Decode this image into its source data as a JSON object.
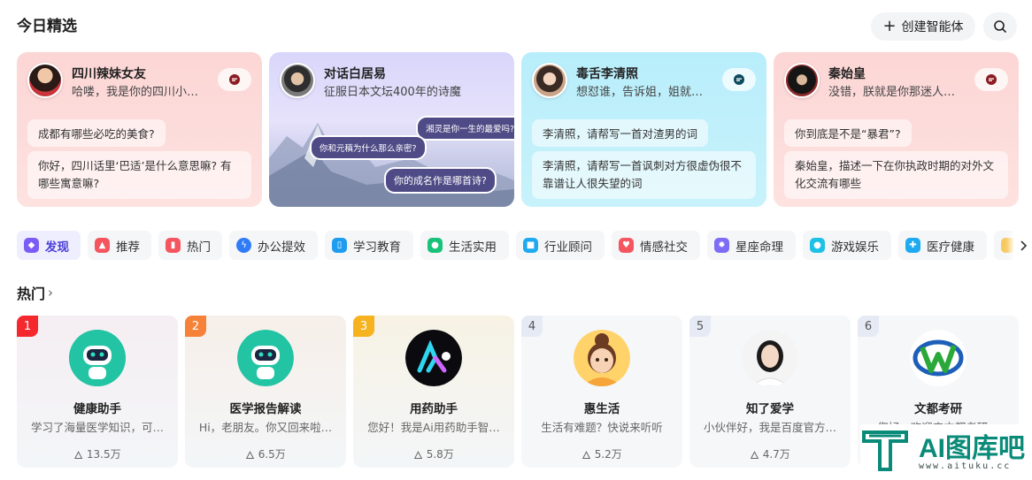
{
  "header": {
    "title": "今日精选",
    "create_label": "创建智能体"
  },
  "featured": [
    {
      "name": "四川辣妹女友",
      "greeting": "哈喽，我是你的四川小…",
      "q": "成都有哪些必吃的美食?",
      "a": "你好，四川话里‘巴适’是什么意思嘛? 有哪些寓意嘛?",
      "bg": "#fdd7d6"
    },
    {
      "name": "对话白居易",
      "greeting": "征服日本文坛400年的诗魔",
      "bubbles": [
        "湘灵是你一生的最爱吗?",
        "你和元稹为什么那么亲密?",
        "你的成名作是哪首诗?"
      ],
      "bg": "#dcd8fb"
    },
    {
      "name": "毒舌李清照",
      "greeting": "想怼谁，告诉姐，姐就…",
      "q": "李清照，请帮写一首对渣男的词",
      "a": "李清照，请帮写一首讽刺对方很虚伪很不靠谱让人很失望的词",
      "bg": "#bff0fb"
    },
    {
      "name": "秦始皇",
      "greeting": "没错，朕就是你那迷人…",
      "q": "你到底是不是“暴君”?",
      "a": "秦始皇，描述一下在你执政时期的对外文化交流有哪些",
      "bg": "#fdd7d6"
    }
  ],
  "tabs": [
    {
      "label": "发现",
      "color": "#7c5cf6"
    },
    {
      "label": "推荐",
      "color": "#f4555e"
    },
    {
      "label": "热门",
      "color": "#f4555e"
    },
    {
      "label": "办公提效",
      "color": "#2f7cf6"
    },
    {
      "label": "学习教育",
      "color": "#1d9cf0"
    },
    {
      "label": "生活实用",
      "color": "#19c27a"
    },
    {
      "label": "行业顾问",
      "color": "#1eaaf1"
    },
    {
      "label": "情感社交",
      "color": "#f4555e"
    },
    {
      "label": "星座命理",
      "color": "#7c6cf6"
    },
    {
      "label": "游戏娱乐",
      "color": "#1ec1e6"
    },
    {
      "label": "医疗健康",
      "color": "#1eaaf1"
    }
  ],
  "hot": {
    "title": "热门",
    "items": [
      {
        "rank": "1",
        "name": "健康助手",
        "desc": "学习了海量医学知识，可…",
        "count": "13.5万"
      },
      {
        "rank": "2",
        "name": "医学报告解读",
        "desc": "Hi，老朋友。你又回来啦…",
        "count": "6.5万"
      },
      {
        "rank": "3",
        "name": "用药助手",
        "desc": "您好！我是Ai用药助手智…",
        "count": "5.8万"
      },
      {
        "rank": "4",
        "name": "惠生活",
        "desc": "生活有难题？快说来听听",
        "count": "5.2万"
      },
      {
        "rank": "5",
        "name": "知了爱学",
        "desc": "小伙伴好，我是百度官方…",
        "count": "4.7万"
      },
      {
        "rank": "6",
        "name": "文都考研",
        "desc": "您好，欢迎来文都考研…",
        "count": ""
      }
    ]
  },
  "watermark": {
    "text": "AI图库吧",
    "url": "www.aituku.cc"
  }
}
